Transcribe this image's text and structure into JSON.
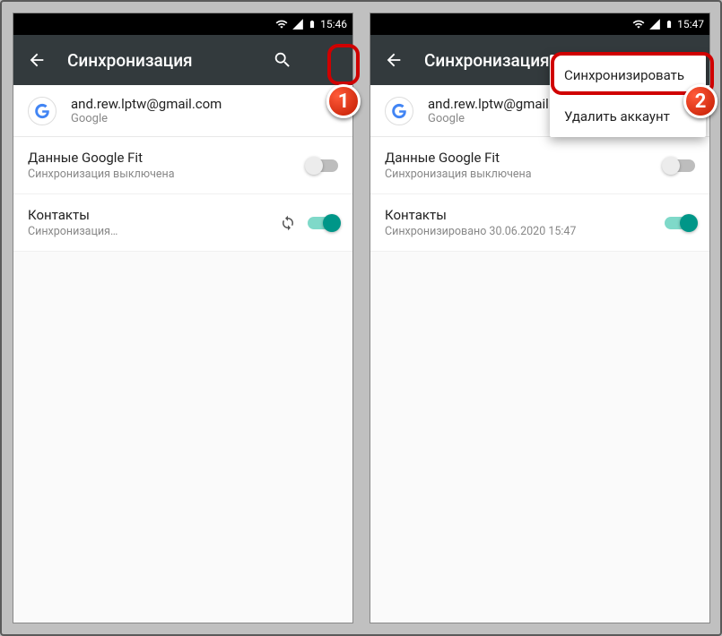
{
  "left": {
    "status_time": "15:46",
    "appbar": {
      "title": "Синхронизация"
    },
    "account": {
      "email": "and.rew.lptw@gmail.com",
      "provider": "Google"
    },
    "rows": [
      {
        "title": "Данные Google Fit",
        "subtitle": "Синхронизация выключена",
        "syncing": false,
        "on": false
      },
      {
        "title": "Контакты",
        "subtitle": "Синхронизация…",
        "syncing": true,
        "on": true
      }
    ]
  },
  "right": {
    "status_time": "15:47",
    "appbar": {
      "title": "Синхронизация"
    },
    "account": {
      "email": "and.rew.lptw@gmail.com",
      "provider": "Google"
    },
    "rows": [
      {
        "title": "Данные Google Fit",
        "subtitle": "Синхронизация выключена",
        "syncing": false,
        "on": false
      },
      {
        "title": "Контакты",
        "subtitle": "Синхронизировано 30.06.2020 15:47",
        "syncing": false,
        "on": true
      }
    ],
    "menu": {
      "sync_now": "Синхронизировать",
      "delete": "Удалить аккаунт"
    }
  },
  "callouts": {
    "one": "1",
    "two": "2"
  }
}
